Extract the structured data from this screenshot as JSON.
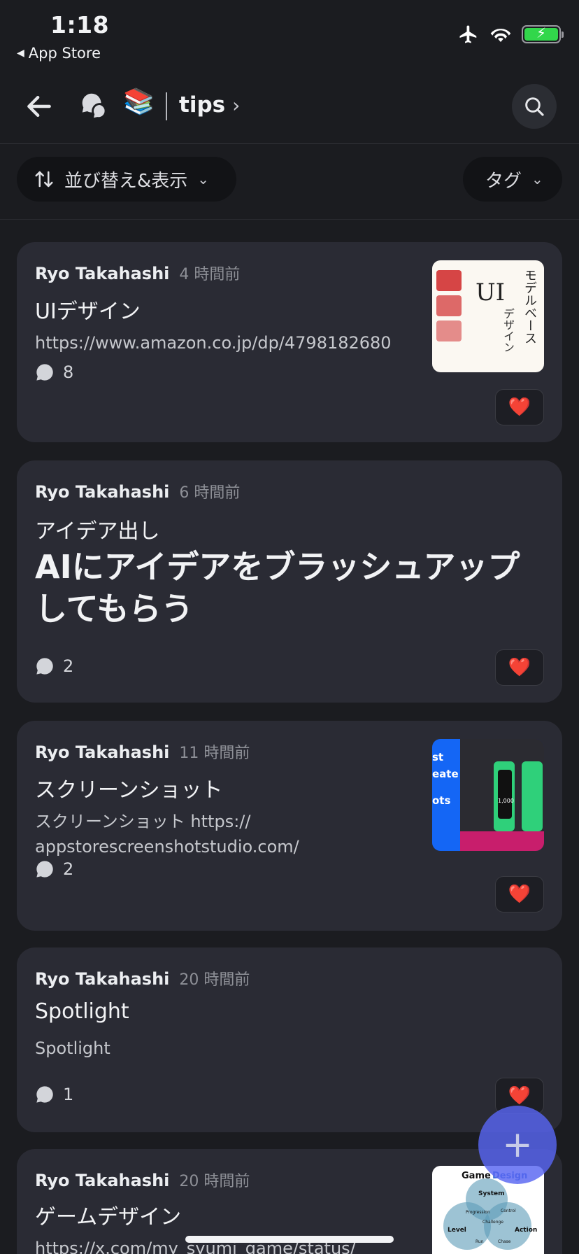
{
  "status": {
    "time": "1:18",
    "back_app": "App Store"
  },
  "header": {
    "channel": "tips",
    "emoji": "📚"
  },
  "filters": {
    "sort_label": "並び替え&表示",
    "tags_label": "タグ"
  },
  "posts": [
    {
      "author": "Ryo Takahashi",
      "ago": "4 時間前",
      "title": "UIデザイン",
      "body": "https://www.amazon.co.jp/dp/4798182680",
      "comments": "8",
      "reaction": "❤️",
      "thumb": {
        "line1": "モデルベース",
        "line2": "UI",
        "line3": "デザイン"
      }
    },
    {
      "author": "Ryo Takahashi",
      "ago": "6 時間前",
      "title": "アイデア出し",
      "body": "AIにアイデアをブラッシュアップしてもらう",
      "comments": "2",
      "reaction": "❤️"
    },
    {
      "author": "Ryo Takahashi",
      "ago": "11 時間前",
      "title": "スクリーンショット",
      "body_line1": "スクリーンショット  https://",
      "body_line2": "appstorescreenshotstudio.com/",
      "comments": "2",
      "reaction": "❤️",
      "thumb": {
        "l1": "st",
        "l2": "eate",
        "l3": "ots",
        "price": "1,000"
      }
    },
    {
      "author": "Ryo Takahashi",
      "ago": "20 時間前",
      "title": "Spotlight",
      "body": "Spotlight",
      "comments": "1",
      "reaction": "❤️"
    },
    {
      "author": "Ryo Takahashi",
      "ago": "20 時間前",
      "title": "ゲームデザイン",
      "body": "https://x.com/my_syumi_game/status/",
      "thumb": {
        "title_a": "Game ",
        "title_b": "Design",
        "c1": "System",
        "c2": "Level",
        "c3": "Action",
        "c4": "Progression",
        "c5": "Control",
        "c6": "Challenge",
        "c7": "Run",
        "c8": "Chase"
      }
    }
  ],
  "fab": {
    "label": "+"
  }
}
